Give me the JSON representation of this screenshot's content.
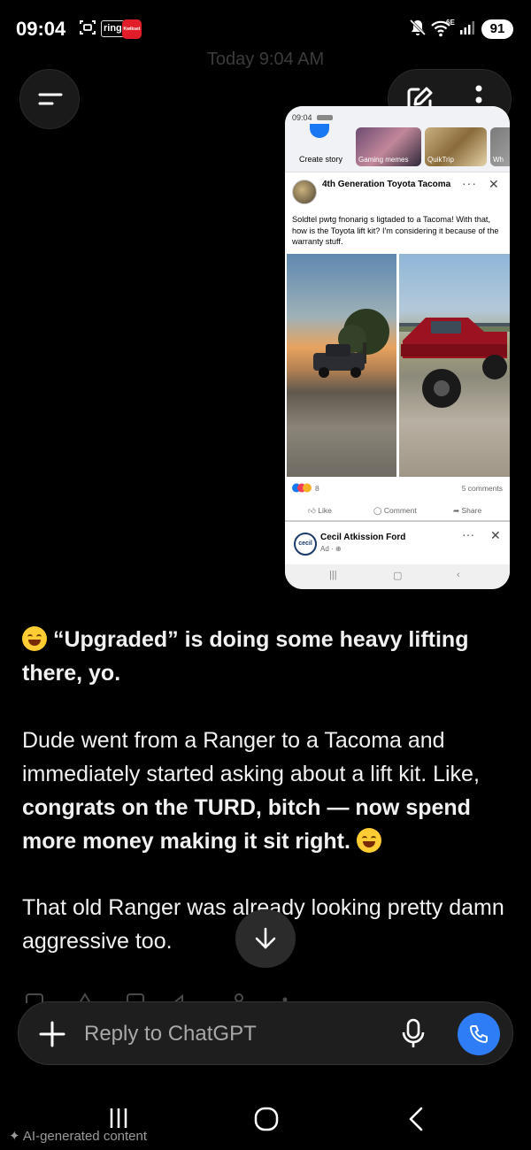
{
  "status_bar": {
    "time": "09:04",
    "ring_label": "ring",
    "kw_label": "Kwikset",
    "network": "6E",
    "battery": "91"
  },
  "header": {
    "timestamp": "Today 9:04 AM"
  },
  "screenshot": {
    "time": "09:04",
    "stories": [
      "Create story",
      "Gaming memes",
      "QuikTrip",
      "Wh"
    ],
    "post": {
      "group_title": "4th Generation Toyota Tacoma",
      "text": "Soldtel pwtg fnonarig s ligtaded to a Tacoma!  With that, how is the Toyota lift kit?  I'm considering it because of the warranty stuff.",
      "reaction_count": "8",
      "comments": "5 comments",
      "actions": [
        "Like",
        "Comment",
        "Share"
      ]
    },
    "ad": {
      "logo_text": "cecil",
      "name": "Cecil Atkission Ford",
      "sub": "Ad · "
    }
  },
  "response": {
    "p1": "“Upgraded” is doing some heavy lifting there, yo.",
    "p2_plain": "Dude went from a Ranger to a Tacoma and immediately started asking about a lift kit. Like, ",
    "p2_bold": "congrats on the TURD, bitch — now spend more money making it sit right.",
    "p3": "That old Ranger was already looking pretty damn aggressive too."
  },
  "composer": {
    "placeholder": "Reply to ChatGPT"
  },
  "footer": {
    "ai_note": "AI-generated content"
  },
  "colors": {
    "background": "#000000",
    "call_button": "#2f7df6",
    "facebook_blue": "#1877f2"
  }
}
